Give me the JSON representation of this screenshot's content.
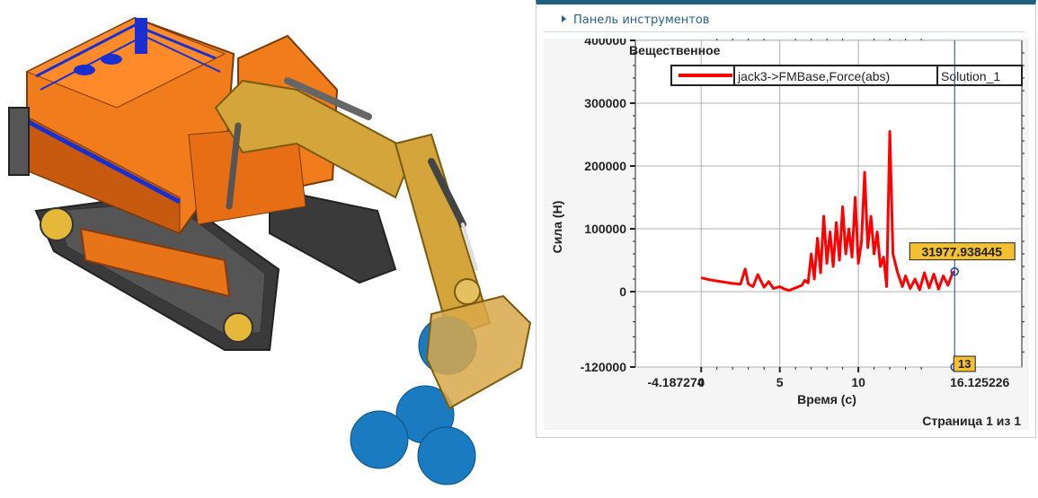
{
  "toolbar": {
    "label": "Панель инструментов",
    "icon": "expand-arrow-icon"
  },
  "colors": {
    "series": "#ff0000",
    "cursor": "#1a3fa0",
    "label_bg": "#f2c030",
    "panel_accent": "#1f5f7f"
  },
  "footer": {
    "page": "Страница 1 из 1"
  },
  "cursor": {
    "x": 16.125226,
    "x_label": "16.125226",
    "x_min_label": "-4.187274",
    "value_label": "31977.938445",
    "frame_label": "13"
  },
  "chart_data": {
    "type": "line",
    "title": "Вещественное",
    "xlabel": "Время (с)",
    "ylabel": "Сила (Н)",
    "xlim": [
      -4.187274,
      20.4
    ],
    "ylim": [
      -120000,
      400000
    ],
    "x_ticks": [
      0,
      5,
      10
    ],
    "y_ticks": [
      -120000,
      0,
      100000,
      200000,
      300000,
      400000
    ],
    "x_tick_labels": [
      "0",
      "5",
      "10"
    ],
    "y_tick_labels": [
      "-120000",
      "0",
      "100000",
      "200000",
      "300000",
      "400000"
    ],
    "grid": true,
    "legend": "top",
    "series": [
      {
        "name": "jack3->FMBase,Force(abs)",
        "solution": "Solution_1",
        "x": [
          0,
          0.5,
          1,
          1.5,
          2,
          2.5,
          2.8,
          3,
          3.3,
          3.6,
          4,
          4.3,
          4.6,
          5,
          5.3,
          5.6,
          6,
          6.4,
          6.6,
          6.8,
          7.0,
          7.2,
          7.4,
          7.6,
          7.8,
          8.0,
          8.2,
          8.4,
          8.6,
          8.8,
          9.0,
          9.2,
          9.4,
          9.6,
          9.8,
          10.0,
          10.2,
          10.4,
          10.6,
          10.8,
          11.0,
          11.2,
          11.4,
          11.6,
          11.8,
          12.0,
          12.2,
          12.5,
          12.8,
          13.0,
          13.3,
          13.6,
          13.9,
          14.2,
          14.5,
          14.8,
          15.1,
          15.4,
          15.7,
          16.0,
          16.125226
        ],
        "y": [
          22000,
          19000,
          17000,
          15000,
          13000,
          12000,
          36000,
          12000,
          8000,
          27000,
          7000,
          16000,
          5000,
          8000,
          4000,
          2000,
          6000,
          10000,
          18000,
          14000,
          60000,
          20000,
          85000,
          30000,
          120000,
          45000,
          95000,
          40000,
          110000,
          50000,
          135000,
          60000,
          100000,
          55000,
          150000,
          45000,
          80000,
          190000,
          70000,
          120000,
          60000,
          95000,
          40000,
          55000,
          8000,
          255000,
          60000,
          30000,
          8000,
          25000,
          5000,
          20000,
          3000,
          30000,
          6000,
          28000,
          4000,
          25000,
          10000,
          30000,
          31978
        ]
      }
    ]
  }
}
